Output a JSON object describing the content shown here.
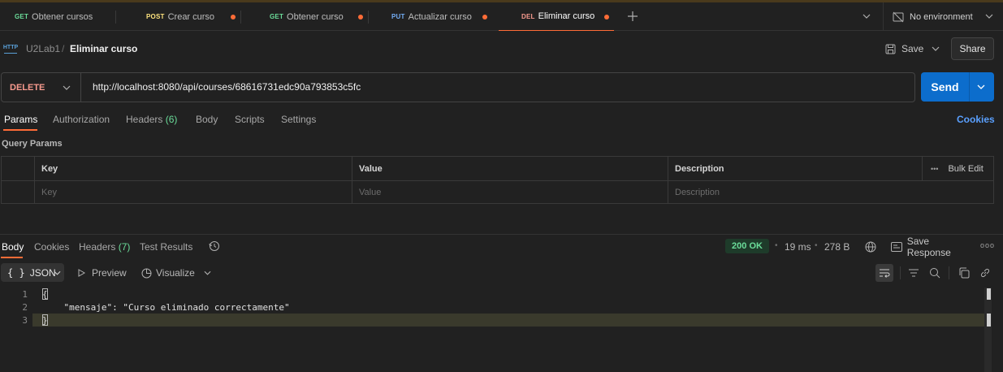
{
  "tabs": [
    {
      "method": "GET",
      "label": "Obtener cursos",
      "unsaved": false,
      "active": false
    },
    {
      "method": "POST",
      "label": "Crear curso",
      "unsaved": true,
      "active": false
    },
    {
      "method": "GET",
      "label": "Obtener curso",
      "unsaved": true,
      "active": false
    },
    {
      "method": "PUT",
      "label": "Actualizar curso",
      "unsaved": true,
      "active": false
    },
    {
      "method": "DEL",
      "label": "Eliminar curso",
      "unsaved": true,
      "active": true
    }
  ],
  "environment": {
    "label": "No environment"
  },
  "breadcrumb": {
    "collection": "U2Lab1",
    "separator": "/",
    "request": "Eliminar curso",
    "http_badge": "HTTP"
  },
  "toolbar": {
    "save_label": "Save",
    "share_label": "Share"
  },
  "request": {
    "method": "DELETE",
    "url": "http://localhost:8080/api/courses/68616731edc90a793853c5fc",
    "send_label": "Send"
  },
  "request_tabs": {
    "params": "Params",
    "authorization": "Authorization",
    "headers": "Headers",
    "headers_count": "(6)",
    "body": "Body",
    "scripts": "Scripts",
    "settings": "Settings",
    "cookies": "Cookies"
  },
  "query_params": {
    "title": "Query Params",
    "columns": {
      "key": "Key",
      "value": "Value",
      "description": "Description"
    },
    "bulk_edit": "Bulk Edit",
    "more": "•••",
    "placeholders": {
      "key": "Key",
      "value": "Value",
      "description": "Description"
    }
  },
  "response_tabs": {
    "body": "Body",
    "cookies": "Cookies",
    "headers": "Headers",
    "headers_count": "(7)",
    "test_results": "Test Results"
  },
  "response_meta": {
    "status": "200 OK",
    "time": "19 ms",
    "size": "278 B",
    "save_response": "Save Response",
    "more": "ooo",
    "dot": "•"
  },
  "body_view": {
    "format": "JSON",
    "braces": "{ }",
    "preview": "Preview",
    "visualize": "Visualize"
  },
  "code_lines": [
    {
      "n": "1",
      "text": "{"
    },
    {
      "n": "2",
      "text": "    \"mensaje\": \"Curso eliminado correctamente\""
    },
    {
      "n": "3",
      "text": "}"
    }
  ],
  "colors": {
    "accent": "#ff6c37",
    "send": "#0c6dcc",
    "status_ok": "#6bdd9a",
    "delete": "#f79a8e"
  }
}
